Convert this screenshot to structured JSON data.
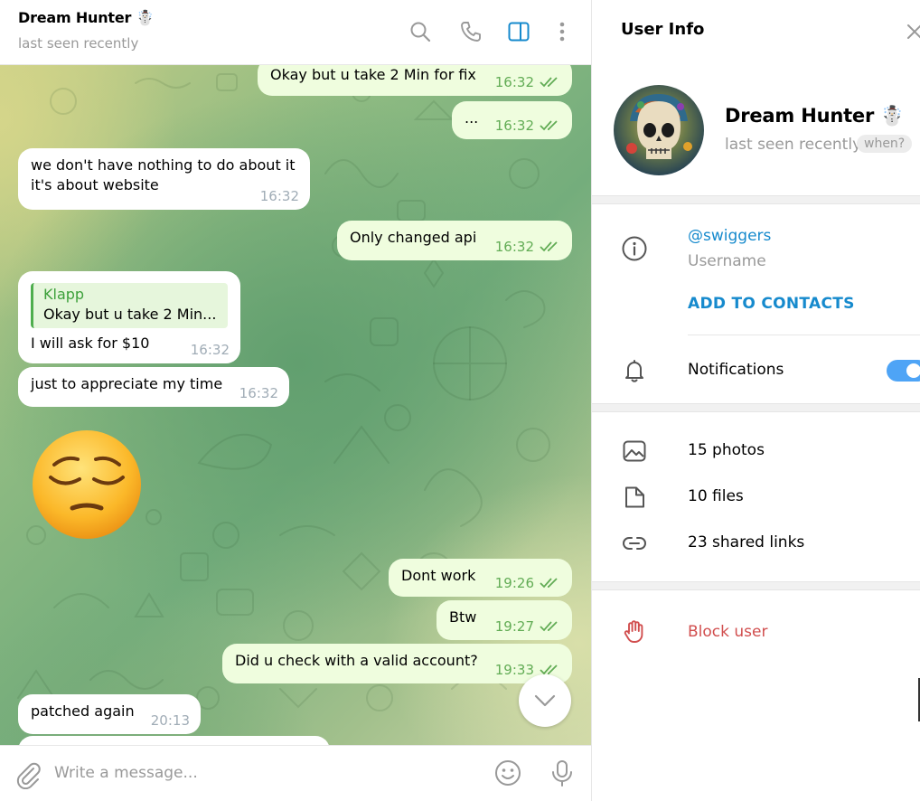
{
  "chat": {
    "peer_name": "Dream Hunter ☃️",
    "peer_status": "last seen recently",
    "header_icons": [
      "search-icon",
      "phone-icon",
      "sidebar-toggle-icon",
      "more-vertical-icon"
    ],
    "messages": [
      {
        "direction": "out",
        "text": "Okay but u take 2 Min for fix",
        "time": "16:32",
        "read": true
      },
      {
        "direction": "out",
        "text": "...",
        "time": "16:32",
        "read": true
      },
      {
        "direction": "in",
        "text": "we don't have nothing to do about it",
        "text2": "it's about website",
        "time": "16:32"
      },
      {
        "direction": "out",
        "text": "Only changed api",
        "time": "16:32",
        "read": true
      },
      {
        "direction": "in",
        "reply_author": "Klapp",
        "reply_text": "Okay but u take 2 Min...",
        "text": "I will ask for $10",
        "time": "16:32"
      },
      {
        "direction": "in",
        "text": "just to appreciate my time",
        "time": "16:32"
      },
      {
        "direction": "in",
        "sticker": "pensive-face-emoji"
      },
      {
        "direction": "out",
        "text": "Dont work",
        "time": "19:26",
        "read": true
      },
      {
        "direction": "out",
        "text": "Btw",
        "time": "19:27",
        "read": true
      },
      {
        "direction": "out",
        "text": "Did u check with a valid account?",
        "time": "19:33",
        "read": true
      },
      {
        "direction": "in",
        "text": "patched again",
        "time": "20:13"
      }
    ],
    "composer_placeholder": "Write a message...",
    "composer_icons": [
      "attach-icon",
      "emoji-icon",
      "microphone-icon"
    ]
  },
  "info": {
    "title": "User Info",
    "name": "Dream Hunter ☃️",
    "status": "last seen recently",
    "when_label": "when?",
    "username": "@swiggers",
    "username_caption": "Username",
    "add_contacts": "ADD TO CONTACTS",
    "notifications_label": "Notifications",
    "notifications_on": true,
    "media": {
      "photos": "15 photos",
      "files": "10 files",
      "links": "23 shared links"
    },
    "block_label": "Block user"
  },
  "colors": {
    "accent": "#168acd",
    "outgoing_bubble": "#effdde",
    "incoming_bubble": "#ffffff",
    "check_green": "#62ac55",
    "danger": "#d14e4e",
    "toggle_on": "#4ea4f6"
  }
}
